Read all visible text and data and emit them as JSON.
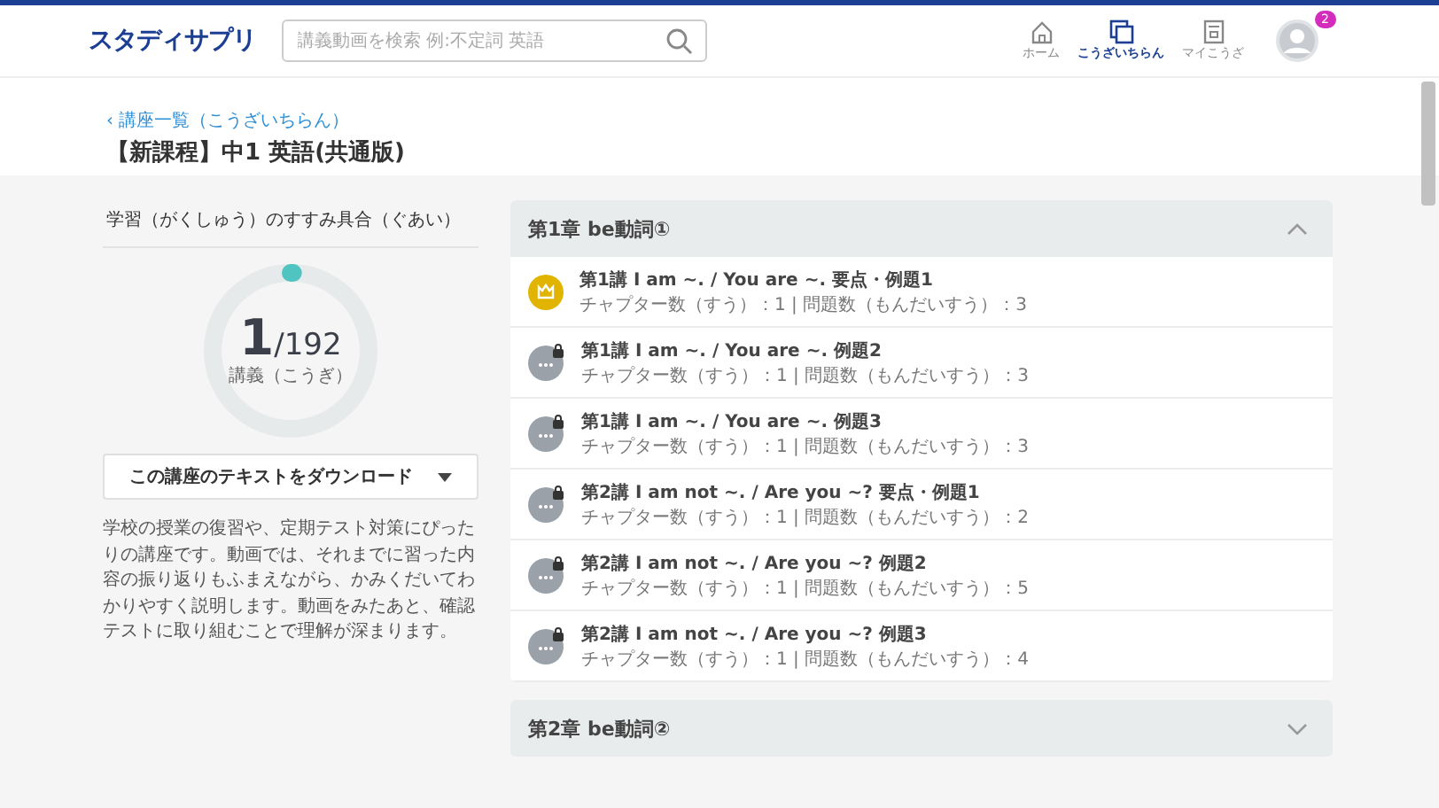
{
  "header": {
    "logo": "スタディサプリ",
    "search": {
      "placeholder": "講義動画を検索 例:不定詞 英語"
    },
    "nav": [
      {
        "label": "ホーム",
        "kind": "home",
        "selected": false
      },
      {
        "label": "こうざいちらん",
        "kind": "courses",
        "selected": true
      },
      {
        "label": "マイこうざ",
        "kind": "mycourse",
        "selected": false
      }
    ],
    "notification_badge": "2"
  },
  "breadcrumb": "‹ 講座一覧（こうざいちらん）",
  "course_title": "【新課程】中1 英語(共通版)",
  "progress": {
    "title": "学習（がくしゅう）のすすみ具合（ぐあい）",
    "done": "1",
    "total": "/192",
    "unit": "講義（こうぎ）",
    "level": 0.005
  },
  "download_button": "この講座のテキストをダウンロード",
  "description": "学校の授業の復習や、定期テスト対策にぴったりの講座です。動画では、それまでに習った内容の振り返りもふまえながら、かみくだいてわかりやすく説明します。動画をみたあと、確認テストに取り組むことで理解が深まります。",
  "chapters": [
    {
      "title": "第1章 be動詞①",
      "expanded": true,
      "lessons": [
        {
          "kind": "completed",
          "title": "第1講 I am ~. / You are ~. 要点・例題1",
          "meta": "チャプター数（すう）：1 | 問題数（もんだいすう）：3"
        },
        {
          "kind": "locked",
          "title": "第1講 I am ~. / You are ~. 例題2",
          "meta": "チャプター数（すう）：1 | 問題数（もんだいすう）：3"
        },
        {
          "kind": "locked",
          "title": "第1講 I am ~. / You are ~. 例題3",
          "meta": "チャプター数（すう）：1 | 問題数（もんだいすう）：3"
        },
        {
          "kind": "locked",
          "title": "第2講 I am not ~. / Are you ~? 要点・例題1",
          "meta": "チャプター数（すう）：1 | 問題数（もんだいすう）：2"
        },
        {
          "kind": "locked",
          "title": "第2講 I am not ~. / Are you ~? 例題2",
          "meta": "チャプター数（すう）：1 | 問題数（もんだいすう）：5"
        },
        {
          "kind": "locked",
          "title": "第2講 I am not ~. / Are you ~? 例題3",
          "meta": "チャプター数（すう）：1 | 問題数（もんだいすう）：4"
        }
      ]
    },
    {
      "title": "第2章 be動詞②",
      "expanded": false
    }
  ]
}
